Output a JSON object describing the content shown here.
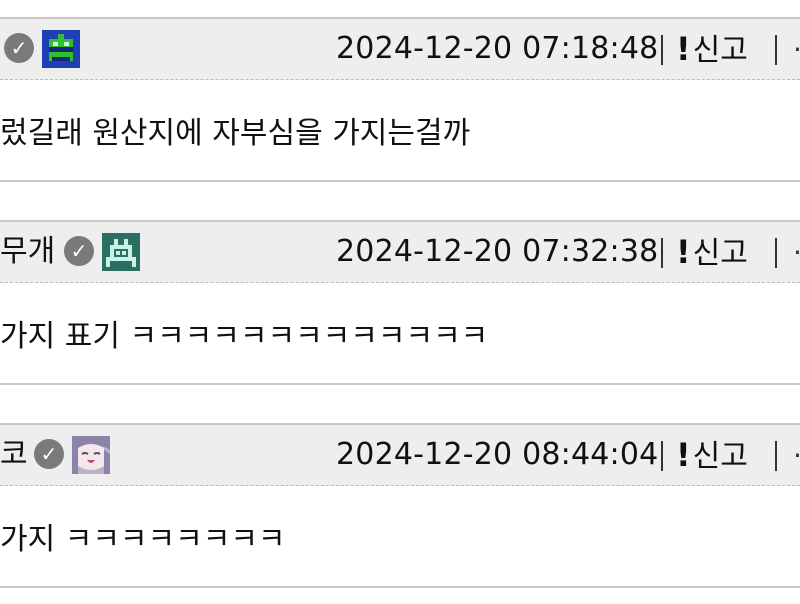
{
  "comments": [
    {
      "nickname": "",
      "timestamp": "2024-12-20 07:18:48",
      "report_label": "신고",
      "report_mark": "!",
      "text": "렀길래 원산지에 자부심을 가지는걸까"
    },
    {
      "nickname": "무개",
      "timestamp": "2024-12-20 07:32:38",
      "report_label": "신고",
      "report_mark": "!",
      "text": "가지 표기 ㅋㅋㅋㅋㅋㅋㅋㅋㅋㅋㅋㅋㅋ"
    },
    {
      "nickname": "코",
      "timestamp": "2024-12-20 08:44:04",
      "report_label": "신고",
      "report_mark": "!",
      "text": "가지 ㅋㅋㅋㅋㅋㅋㅋㅋ"
    }
  ],
  "icons": {
    "verified": "check-circle-icon",
    "avatar_1": "green-robot-avatar",
    "avatar_2": "green-robot-outline-avatar",
    "avatar_3": "anime-character-avatar",
    "more": "more-icon"
  },
  "colors": {
    "header_bg": "#eeeeee",
    "divider": "#c9c9c9",
    "verified_badge": "#7a7a7a"
  }
}
